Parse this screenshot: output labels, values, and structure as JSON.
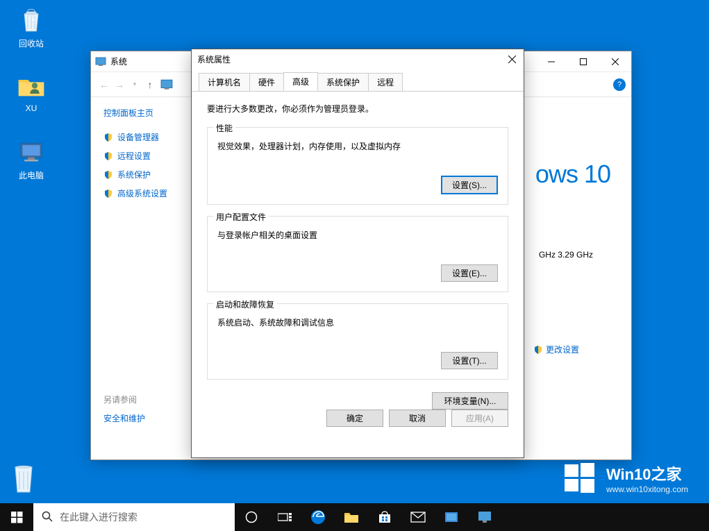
{
  "desktop": {
    "recycle_bin": "回收站",
    "user_folder": "XU",
    "this_pc": "此电脑"
  },
  "sys_window": {
    "title": "系统",
    "side": {
      "home": "控制面板主页",
      "device_manager": "设备管理器",
      "remote_settings": "远程设置",
      "system_protection": "系统保护",
      "advanced_settings": "高级系统设置",
      "also_see": "另请参阅",
      "security_maintenance": "安全和维护"
    },
    "main": {
      "windows10": "ows 10",
      "ghz": "GHz   3.29 GHz",
      "change_settings": "更改设置"
    }
  },
  "dialog": {
    "title": "系统属性",
    "tabs": {
      "computer_name": "计算机名",
      "hardware": "硬件",
      "advanced": "高级",
      "system_protection": "系统保护",
      "remote": "远程"
    },
    "instruction": "要进行大多数更改，你必须作为管理员登录。",
    "performance": {
      "legend": "性能",
      "desc": "视觉效果，处理器计划，内存使用，以及虚拟内存",
      "button": "设置(S)..."
    },
    "userprofile": {
      "legend": "用户配置文件",
      "desc": "与登录帐户相关的桌面设置",
      "button": "设置(E)..."
    },
    "startup": {
      "legend": "启动和故障恢复",
      "desc": "系统启动、系统故障和调试信息",
      "button": "设置(T)..."
    },
    "env_vars": "环境变量(N)...",
    "ok": "确定",
    "cancel": "取消",
    "apply": "应用(A)"
  },
  "taskbar": {
    "search_placeholder": "在此键入进行搜索"
  },
  "watermark": {
    "title": "Win10之家",
    "url": "www.win10xitong.com"
  }
}
